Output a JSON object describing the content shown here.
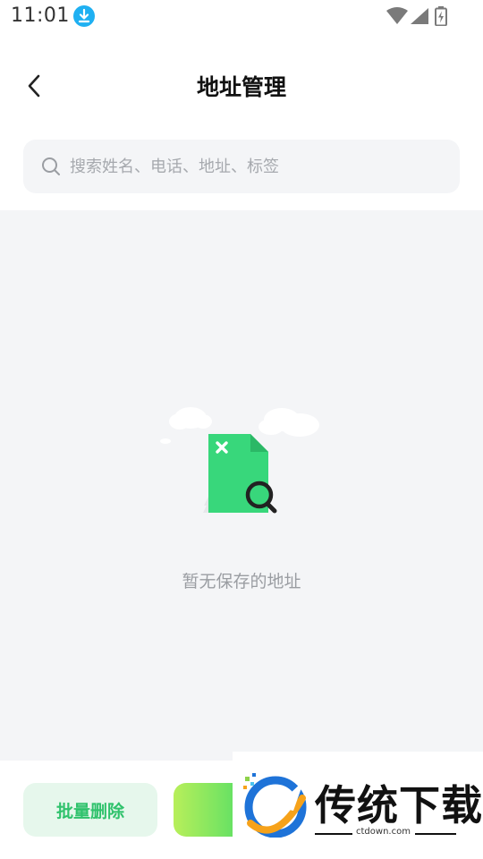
{
  "status_bar": {
    "time": "11:01",
    "icons": [
      "download-icon",
      "wifi-icon",
      "signal-icon",
      "battery-icon"
    ]
  },
  "header": {
    "title": "地址管理",
    "back_icon": "chevron-left-icon"
  },
  "search": {
    "placeholder": "搜索姓名、电话、地址、标签",
    "value": "",
    "icon": "search-icon"
  },
  "empty_state": {
    "illustration": "empty-document-search-icon",
    "message": "暂无保存的地址"
  },
  "bottom_bar": {
    "batch_delete_label": "批量删除",
    "add_button_label": ""
  },
  "watermark": {
    "brand": "传统下载",
    "url": "ctdown.com"
  },
  "colors": {
    "accent_green": "#2fc26c",
    "batch_bg": "#e6f7ec",
    "download_badge": "#1fb0f2",
    "content_bg": "#f4f5f7"
  }
}
